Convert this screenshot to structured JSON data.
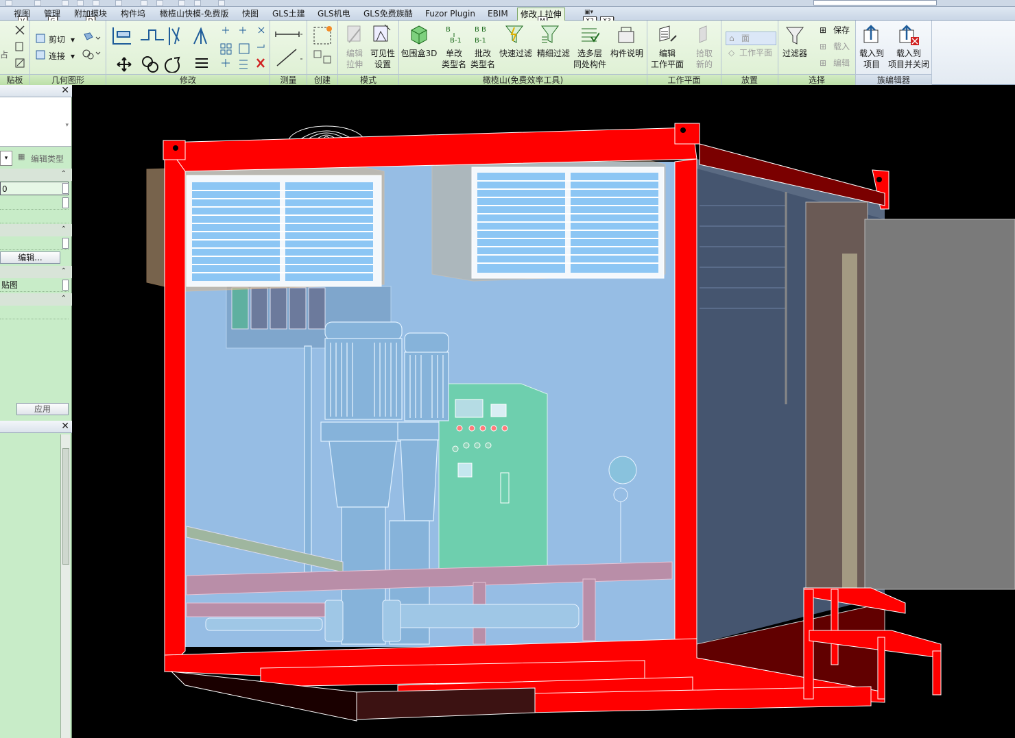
{
  "app": {
    "tabs": [
      "视图",
      "管理",
      "附加模块",
      "构件坞",
      "橄榄山快模-免费版",
      "快图",
      "GLS土建",
      "GLS机电",
      "GLS免费族酷",
      "Fuzor Plugin",
      "EBIM",
      "修改 | 拉伸"
    ],
    "keytips": {
      "view": "V",
      "manage": "G",
      "addins": "D",
      "modify_extrude": "M",
      "x2": "X2",
      "x3": "X3"
    }
  },
  "ribbon": {
    "clipboard": {
      "label": "贴板"
    },
    "geometry": {
      "label": "几何图形",
      "cut": "剪切",
      "join": "连接"
    },
    "modify": {
      "label": "修改"
    },
    "measure": {
      "label": "测量"
    },
    "create": {
      "label": "创建"
    },
    "mode": {
      "label": "模式",
      "edit_extrusion": "编辑\n拉伸",
      "visibility_settings": "可见性\n设置"
    },
    "gls_tools": {
      "label": "橄榄山(免费效率工具)",
      "bbox3d": "包围盒3D",
      "rename_single": "单改\n类型名",
      "rename_batch": "批改\n类型名",
      "quick_filter": "快速过滤",
      "fine_filter": "精细过滤",
      "multi_level_select": "选多层\n同处构件",
      "component_desc": "构件说明",
      "b1": "B-1"
    },
    "workplane": {
      "label": "工作平面",
      "edit_workplane": "编辑\n工作平面",
      "pick_new": "拾取\n新的"
    },
    "placement": {
      "label": "放置",
      "face": "面",
      "work_plane": "工作平面"
    },
    "selection": {
      "label": "选择",
      "filter": "过滤器",
      "save": "保存",
      "load": "载入",
      "edit": "编辑"
    },
    "family_editor": {
      "label": "族编辑器",
      "load_into_project": "载入到\n项目",
      "load_into_project_close": "载入到\n项目并关闭"
    }
  },
  "properties": {
    "edit_type": "编辑类型",
    "value_0": "0",
    "edit_button": "编辑...",
    "decal_row": "贴图",
    "apply": "应用"
  },
  "colors": {
    "frame_red": "#ff0000",
    "dark_red": "#7a0000",
    "glass_blue": "#8fb8e0",
    "panel_green": "#c8ecc8",
    "cabinet_green": "#6ecfae"
  }
}
